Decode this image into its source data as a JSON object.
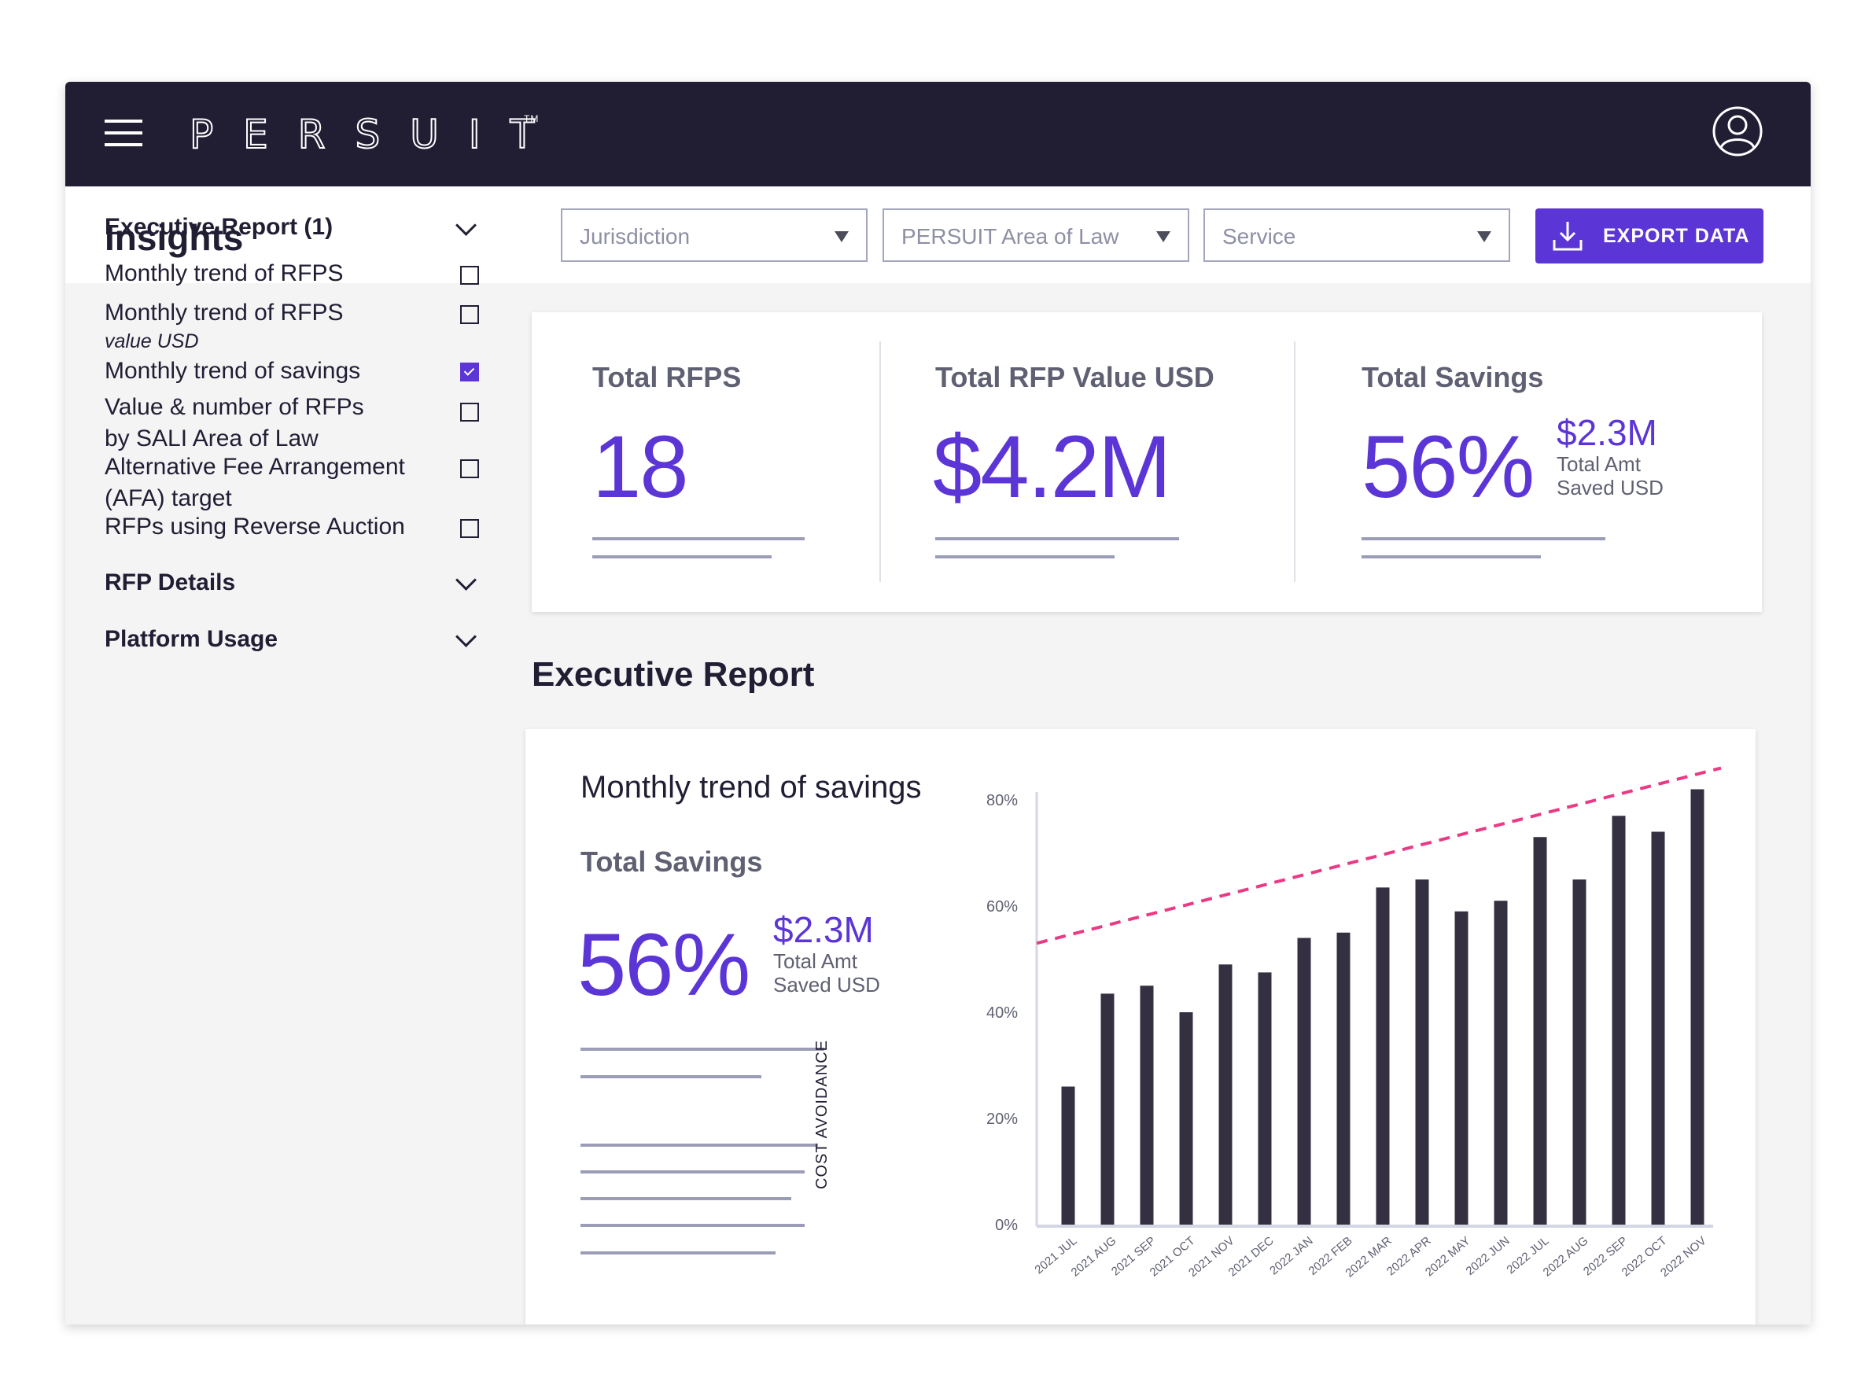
{
  "header": {
    "logo_text": "PERSUIT",
    "trademark": "TM",
    "menu_icon": "hamburger-menu-icon",
    "user_icon": "user-account-icon"
  },
  "toolbar": {
    "title": "Insights",
    "filters": [
      {
        "label": "Jurisdiction"
      },
      {
        "label": "PERSUIT Area of Law"
      },
      {
        "label": "Service"
      }
    ],
    "export_label": "EXPORT DATA",
    "export_icon": "download-icon"
  },
  "colors": {
    "brand_dark": "#211d33",
    "accent": "#5c35d6",
    "trend_line": "#ea3a84",
    "bar": "#343041"
  },
  "sidebar": {
    "sections": [
      {
        "label": "Executive Report (1)",
        "expanded": true
      },
      {
        "label": "RFP Details",
        "expanded": false
      },
      {
        "label": "Platform Usage",
        "expanded": false
      }
    ],
    "items": [
      {
        "label": "Monthly trend of RFPS",
        "sub": "",
        "checked": false
      },
      {
        "label": "Monthly trend of RFPS",
        "sub": "value USD",
        "checked": false
      },
      {
        "label": "Monthly trend of savings",
        "sub": "",
        "checked": true
      },
      {
        "label": "Value & number of RFPs by SALI Area of Law",
        "sub": "",
        "checked": false
      },
      {
        "label": "Alternative Fee Arrangement (AFA) target",
        "sub": "",
        "checked": false
      },
      {
        "label": "RFPs using Reverse Auction",
        "sub": "",
        "checked": false
      }
    ]
  },
  "kpis": [
    {
      "title": "Total RFPS",
      "value": "18"
    },
    {
      "title": "Total RFP Value USD",
      "value": "$4.2M"
    },
    {
      "title": "Total Savings",
      "value": "56%",
      "amount": "$2.3M",
      "caption_line1": "Total Amt",
      "caption_line2": "Saved USD"
    }
  ],
  "report": {
    "heading": "Executive Report",
    "card_title": "Monthly trend of savings",
    "subheading": "Total Savings",
    "value": "56%",
    "amount": "$2.3M",
    "caption_line1": "Total Amt",
    "caption_line2": "Saved USD"
  },
  "chart_data": {
    "type": "bar",
    "title": "Monthly trend of savings",
    "xlabel": "",
    "ylabel": "COST AVOIDANCE",
    "ylim": [
      0,
      80
    ],
    "y_ticks": [
      "0%",
      "20%",
      "40%",
      "60%",
      "80%"
    ],
    "y_tick_values": [
      0,
      20,
      40,
      60,
      80
    ],
    "grid": false,
    "categories": [
      "2021 JUL",
      "2021 AUG",
      "2021 SEP",
      "2021 OCT",
      "2021 NOV",
      "2021 DEC",
      "2022 JAN",
      "2022 FEB",
      "2022 MAR",
      "2022 APR",
      "2022 MAY",
      "2022 JUN",
      "2022 JUL",
      "2022 AUG",
      "2022 SEP",
      "2022 OCT",
      "2022 NOV"
    ],
    "series": [
      {
        "name": "Cost avoidance",
        "values": [
          26,
          43.5,
          45,
          40,
          49,
          47.5,
          54,
          55,
          63.5,
          65,
          59,
          61,
          73,
          65,
          77,
          74,
          82
        ]
      }
    ],
    "trend_line": {
      "style": "dashed",
      "start_value": 53,
      "end_value": 86
    }
  }
}
